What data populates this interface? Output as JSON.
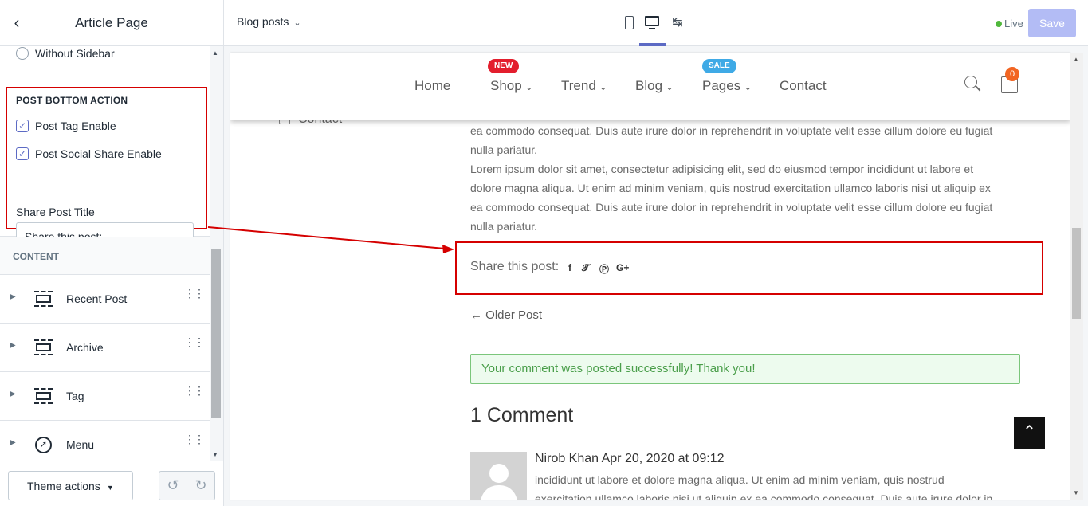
{
  "sidebar": {
    "title": "Article Page",
    "radio_without_sidebar": "Without Sidebar",
    "post_bottom_action": {
      "heading": "POST BOTTOM ACTION",
      "post_tag_enable": "Post Tag Enable",
      "post_social_share_enable": "Post Social Share Enable",
      "share_post_title_label": "Share Post Title",
      "share_post_title_value": "Share this post:"
    },
    "content_heading": "CONTENT",
    "sections": [
      {
        "label": "Recent Post",
        "icon": "section-icon"
      },
      {
        "label": "Archive",
        "icon": "section-icon"
      },
      {
        "label": "Tag",
        "icon": "section-icon"
      },
      {
        "label": "Menu",
        "icon": "compass-icon"
      }
    ],
    "footer": {
      "theme_actions": "Theme actions"
    }
  },
  "topbar": {
    "page_selector": "Blog posts",
    "live_label": "Live",
    "save_label": "Save"
  },
  "preview": {
    "nav": {
      "items": [
        "Home",
        "Shop",
        "Trend",
        "Blog",
        "Pages",
        "Contact"
      ],
      "badge_new": "NEW",
      "badge_sale": "SALE",
      "cart_count": "0"
    },
    "ghost_contact": "Contact",
    "paragraphs": [
      "ea commodo consequat. Duis aute irure dolor in reprehendrit in voluptate velit esse cillum dolore eu fugiat",
      "nulla pariatur.",
      "Lorem ipsum dolor sit amet, consectetur adipisicing elit, sed do eiusmod tempor incididunt ut labore et",
      "dolore magna aliqua. Ut enim ad minim veniam, quis nostrud exercitation ullamco laboris nisi ut aliquip ex",
      "ea commodo consequat. Duis aute irure dolor in reprehendrit in voluptate velit esse cillum dolore eu fugiat",
      "nulla pariatur."
    ],
    "share_title": "Share this post:",
    "social_icons": [
      "facebook-icon",
      "twitter-icon",
      "pinterest-icon",
      "google-plus-icon"
    ],
    "older_post": "← Older Post",
    "comment_alert": "Your comment was posted successfully! Thank you!",
    "comments_title": "1 Comment",
    "comment": {
      "meta": "Nirob Khan Apr 20, 2020 at 09:12",
      "body_lines": [
        "incididunt ut labore et dolore magna aliqua. Ut enim ad minim veniam, quis nostrud",
        "exercitation ullamco laboris nisi ut aliquip ex ea commodo consequat. Duis aute irure dolor in"
      ]
    }
  },
  "colors": {
    "accent": "#5c6ac4",
    "annotation": "#d50000",
    "badge_new": "#e31e2d",
    "badge_sale": "#3faae6",
    "cart_badge": "#f26522"
  }
}
